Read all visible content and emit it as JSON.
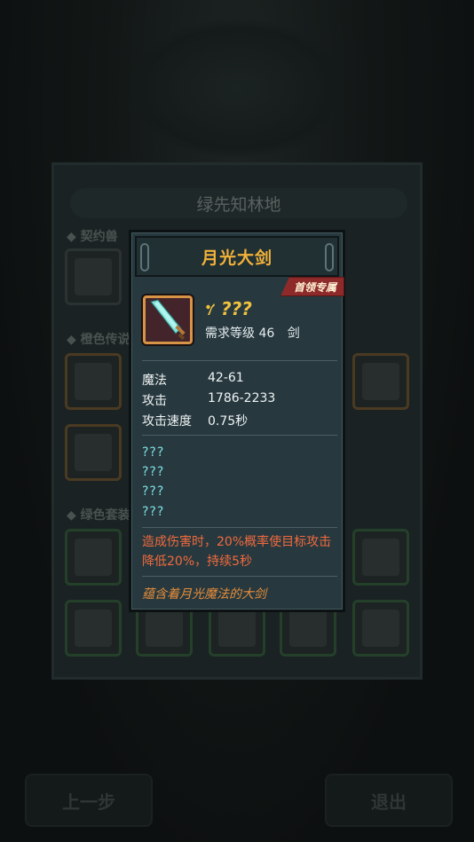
{
  "background": {
    "main_title": "绿先知林地",
    "sections": [
      "契约兽",
      "橙色传说",
      "绿色套装"
    ],
    "buttons": {
      "prev": "上一步",
      "exit": "退出"
    }
  },
  "popup": {
    "title": "月光大剑",
    "badge": "首领专属",
    "item_name": "???",
    "required_level_label": "需求等级",
    "required_level": "46",
    "item_type": "剑",
    "stats": [
      {
        "label": "魔法",
        "value": "42-61"
      },
      {
        "label": "攻击",
        "value": "1786-2233"
      },
      {
        "label": "攻击速度",
        "value": "0.75秒"
      }
    ],
    "unknown_affixes": [
      "???",
      "???",
      "???",
      "???"
    ],
    "special_effect": "造成伤害时，20%概率使目标攻击降低20%，持续5秒",
    "flavor_text": "蕴含着月光魔法的大剑"
  },
  "colors": {
    "title_gold": "#f2b13a",
    "name_yellow": "#f1c23f",
    "affix_cyan": "#7fe0e4",
    "effect_orange_red": "#f26a3d",
    "flavor_orange": "#e88d3a",
    "badge_red": "#8e2a2a"
  }
}
